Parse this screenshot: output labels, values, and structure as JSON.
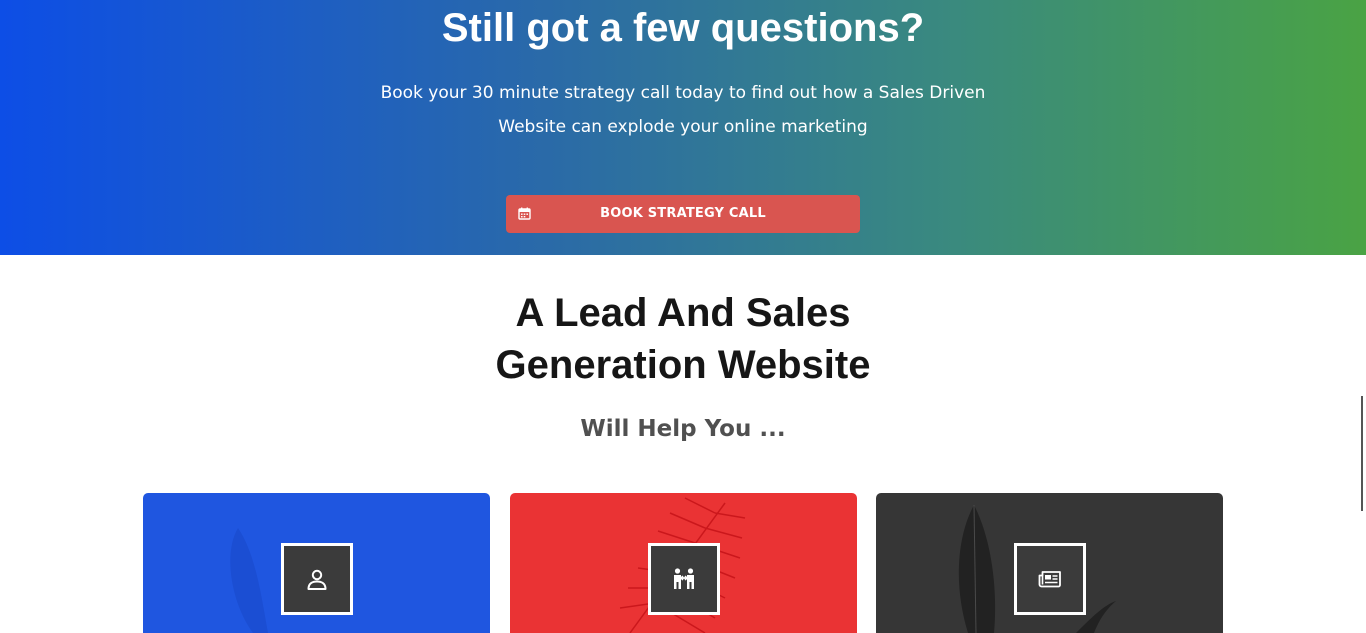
{
  "hero": {
    "title": "Still got a few questions?",
    "subtitle_line1": "Book your 30 minute strategy call today to find out how a Sales Driven",
    "subtitle_line2": "Website can explode your online marketing",
    "cta_label": "BOOK STRATEGY CALL",
    "cta_icon": "calendar-icon",
    "gradient_start": "#0d4ee6",
    "gradient_end": "#4aa344",
    "cta_color": "#d95550"
  },
  "section": {
    "heading_line1": "A Lead And Sales",
    "heading_line2": "Generation Website",
    "subheading": "Will Help You ..."
  },
  "cards": [
    {
      "color": "#1f56e0",
      "icon": "user-icon"
    },
    {
      "color": "#ea3334",
      "icon": "handshake-people-icon"
    },
    {
      "color": "#363636",
      "icon": "newspaper-icon"
    }
  ]
}
